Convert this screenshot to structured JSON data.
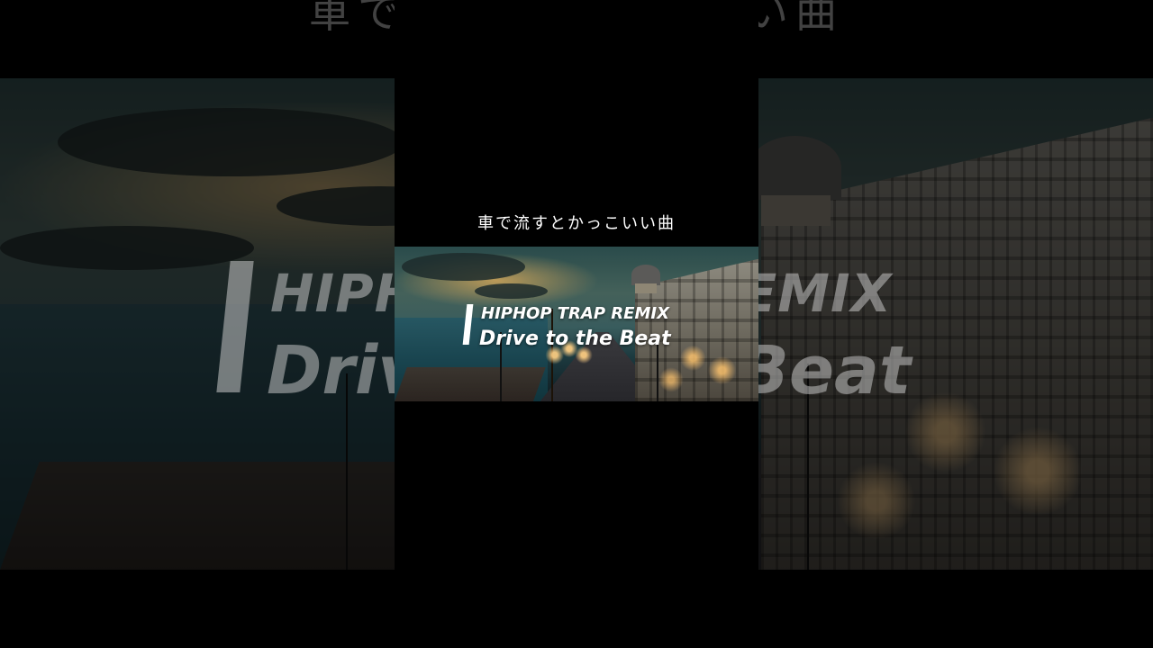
{
  "caption": "車で流すとかっこいい曲",
  "thumbnail": {
    "title_line1": "HIPHOP TRAP REMIX",
    "title_line2": "Drive to the Beat"
  },
  "background": {
    "caption": "車で流すとかっこいい曲",
    "title_line1": "HIPHOP TRAP REMIX",
    "title_line2": "Drive to the Beat"
  },
  "colors": {
    "background": "#000000",
    "text": "#ffffff"
  }
}
